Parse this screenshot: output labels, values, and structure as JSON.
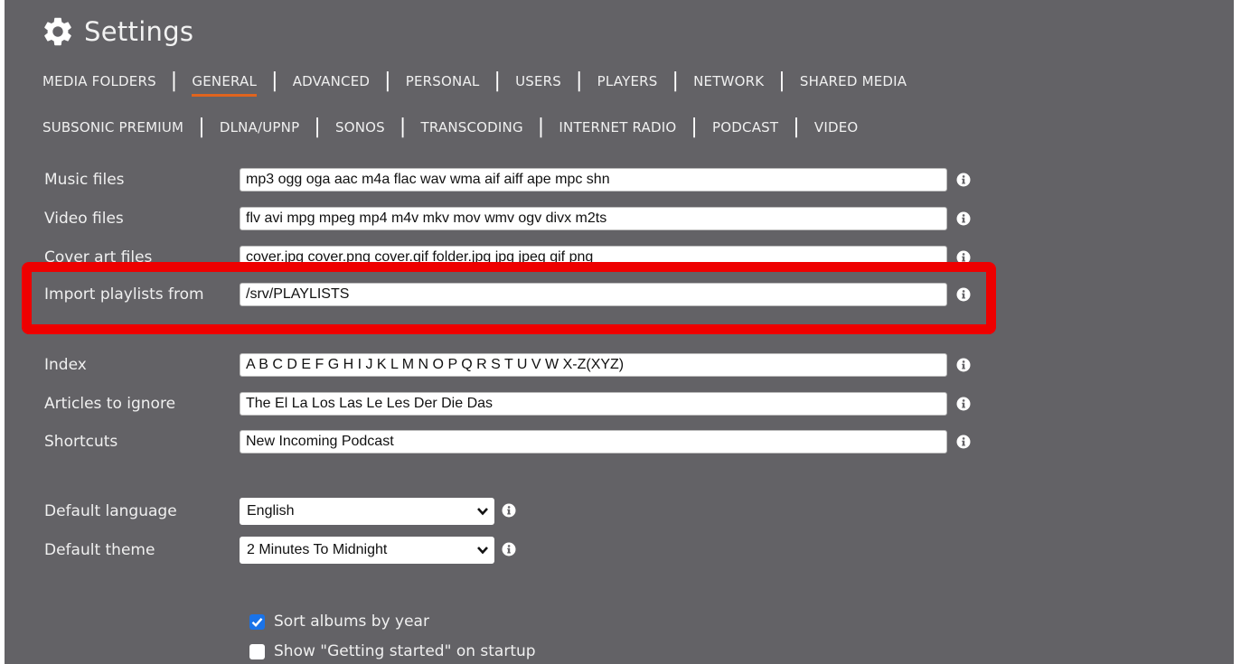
{
  "header": {
    "title": "Settings"
  },
  "tabs_row1": [
    "MEDIA FOLDERS",
    "GENERAL",
    "ADVANCED",
    "PERSONAL",
    "USERS",
    "PLAYERS",
    "NETWORK",
    "SHARED MEDIA"
  ],
  "tabs_row2": [
    "SUBSONIC PREMIUM",
    "DLNA/UPNP",
    "SONOS",
    "TRANSCODING",
    "INTERNET RADIO",
    "PODCAST",
    "VIDEO"
  ],
  "active_tab": "GENERAL",
  "fields": {
    "music_files": {
      "label": "Music files",
      "value": "mp3 ogg oga aac m4a flac wav wma aif aiff ape mpc shn"
    },
    "video_files": {
      "label": "Video files",
      "value": "flv avi mpg mpeg mp4 m4v mkv mov wmv ogv divx m2ts"
    },
    "cover_art_files": {
      "label": "Cover art files",
      "value": "cover.jpg cover.png cover.gif folder.jpg jpg jpeg gif png"
    },
    "import_playlists": {
      "label": "Import playlists from",
      "value": "/srv/PLAYLISTS"
    },
    "index": {
      "label": "Index",
      "value": "A B C D E F G H I J K L M N O P Q R S T U V W X-Z(XYZ)"
    },
    "articles": {
      "label": "Articles to ignore",
      "value": "The El La Los Las Le Les Der Die Das"
    },
    "shortcuts": {
      "label": "Shortcuts",
      "value": "New Incoming Podcast"
    }
  },
  "selects": {
    "language": {
      "label": "Default language",
      "value": "English"
    },
    "theme": {
      "label": "Default theme",
      "value": "2 Minutes To Midnight"
    }
  },
  "checkboxes": {
    "sort_albums": {
      "label": "Sort albums by year",
      "checked": true
    },
    "getting_started": {
      "label": "Show \"Getting started\" on startup",
      "checked": false
    }
  },
  "colors": {
    "panel_bg": "#636266",
    "active_underline": "#e0641e",
    "highlight_border": "#ee0000",
    "checkbox_checked": "#1a73e8"
  },
  "icons": {
    "title": "gear-icon",
    "field_help": "info-icon",
    "select_caret": "chevron-down-icon"
  }
}
